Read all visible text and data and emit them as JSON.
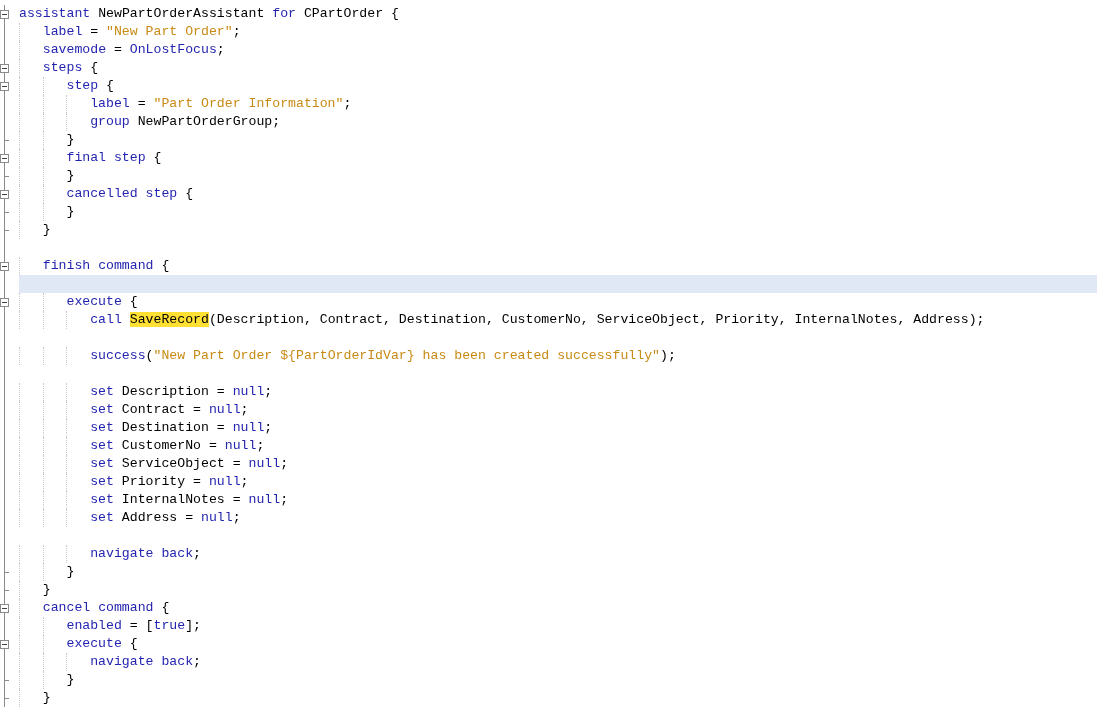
{
  "editor": {
    "lines": [
      {
        "kind": "open",
        "current": false,
        "tokens": [
          {
            "kind": "keyword",
            "text": "assistant "
          },
          {
            "kind": "plain",
            "text": "NewPartOrderAssistant "
          },
          {
            "kind": "keyword",
            "text": "for "
          },
          {
            "kind": "plain",
            "text": "CPartOrder {"
          }
        ]
      },
      {
        "kind": "none",
        "current": false,
        "tokens": [
          {
            "kind": "keyword",
            "text": "   label "
          },
          {
            "kind": "plain",
            "text": "= "
          },
          {
            "kind": "string",
            "text": "\"New Part Order\""
          },
          {
            "kind": "plain",
            "text": ";"
          }
        ]
      },
      {
        "kind": "none",
        "current": false,
        "tokens": [
          {
            "kind": "keyword",
            "text": "   savemode "
          },
          {
            "kind": "plain",
            "text": "= "
          },
          {
            "kind": "keyword",
            "text": "OnLostFocus"
          },
          {
            "kind": "plain",
            "text": ";"
          }
        ]
      },
      {
        "kind": "open",
        "current": false,
        "tokens": [
          {
            "kind": "keyword",
            "text": "   steps "
          },
          {
            "kind": "plain",
            "text": "{"
          }
        ]
      },
      {
        "kind": "open",
        "current": false,
        "tokens": [
          {
            "kind": "keyword",
            "text": "      step "
          },
          {
            "kind": "plain",
            "text": "{"
          }
        ]
      },
      {
        "kind": "none",
        "current": false,
        "tokens": [
          {
            "kind": "keyword",
            "text": "         label "
          },
          {
            "kind": "plain",
            "text": "= "
          },
          {
            "kind": "string",
            "text": "\"Part Order Information\""
          },
          {
            "kind": "plain",
            "text": ";"
          }
        ]
      },
      {
        "kind": "none",
        "current": false,
        "tokens": [
          {
            "kind": "keyword",
            "text": "         group "
          },
          {
            "kind": "plain",
            "text": "NewPartOrderGroup;"
          }
        ]
      },
      {
        "kind": "end",
        "current": false,
        "tokens": [
          {
            "kind": "plain",
            "text": "      }"
          }
        ]
      },
      {
        "kind": "open",
        "current": false,
        "tokens": [
          {
            "kind": "keyword",
            "text": "      final step "
          },
          {
            "kind": "plain",
            "text": "{"
          }
        ]
      },
      {
        "kind": "end",
        "current": false,
        "tokens": [
          {
            "kind": "plain",
            "text": "      }"
          }
        ]
      },
      {
        "kind": "open",
        "current": false,
        "tokens": [
          {
            "kind": "keyword",
            "text": "      cancelled step "
          },
          {
            "kind": "plain",
            "text": "{"
          }
        ]
      },
      {
        "kind": "end",
        "current": false,
        "tokens": [
          {
            "kind": "plain",
            "text": "      }"
          }
        ]
      },
      {
        "kind": "end",
        "current": false,
        "tokens": [
          {
            "kind": "plain",
            "text": "   }"
          }
        ]
      },
      {
        "kind": "none",
        "current": false
      },
      {
        "kind": "open",
        "current": false,
        "tokens": [
          {
            "kind": "keyword",
            "text": "   finish command "
          },
          {
            "kind": "plain",
            "text": "{"
          }
        ]
      },
      {
        "kind": "none",
        "current": true
      },
      {
        "kind": "open",
        "current": false,
        "tokens": [
          {
            "kind": "keyword",
            "text": "      execute "
          },
          {
            "kind": "plain",
            "text": "{"
          }
        ]
      },
      {
        "kind": "none",
        "current": false,
        "tokens": [
          {
            "kind": "keyword",
            "text": "         call "
          },
          {
            "kind": "highlighted",
            "text": "SaveRecord"
          },
          {
            "kind": "plain",
            "text": "(Description, Contract, Destination, CustomerNo, ServiceObject, Priority, InternalNotes, Address);"
          }
        ]
      },
      {
        "kind": "none",
        "current": false
      },
      {
        "kind": "none",
        "current": false,
        "tokens": [
          {
            "kind": "keyword",
            "text": "         success"
          },
          {
            "kind": "plain",
            "text": "("
          },
          {
            "kind": "string",
            "text": "\"New Part Order ${PartOrderIdVar} has been created successfully\""
          },
          {
            "kind": "plain",
            "text": ");"
          }
        ]
      },
      {
        "kind": "none",
        "current": false
      },
      {
        "kind": "none",
        "current": false,
        "tokens": [
          {
            "kind": "keyword",
            "text": "         set "
          },
          {
            "kind": "plain",
            "text": "Description = "
          },
          {
            "kind": "keyword",
            "text": "null"
          },
          {
            "kind": "plain",
            "text": ";"
          }
        ]
      },
      {
        "kind": "none",
        "current": false,
        "tokens": [
          {
            "kind": "keyword",
            "text": "         set "
          },
          {
            "kind": "plain",
            "text": "Contract = "
          },
          {
            "kind": "keyword",
            "text": "null"
          },
          {
            "kind": "plain",
            "text": ";"
          }
        ]
      },
      {
        "kind": "none",
        "current": false,
        "tokens": [
          {
            "kind": "keyword",
            "text": "         set "
          },
          {
            "kind": "plain",
            "text": "Destination = "
          },
          {
            "kind": "keyword",
            "text": "null"
          },
          {
            "kind": "plain",
            "text": ";"
          }
        ]
      },
      {
        "kind": "none",
        "current": false,
        "tokens": [
          {
            "kind": "keyword",
            "text": "         set "
          },
          {
            "kind": "plain",
            "text": "CustomerNo = "
          },
          {
            "kind": "keyword",
            "text": "null"
          },
          {
            "kind": "plain",
            "text": ";"
          }
        ]
      },
      {
        "kind": "none",
        "current": false,
        "tokens": [
          {
            "kind": "keyword",
            "text": "         set "
          },
          {
            "kind": "plain",
            "text": "ServiceObject = "
          },
          {
            "kind": "keyword",
            "text": "null"
          },
          {
            "kind": "plain",
            "text": ";"
          }
        ]
      },
      {
        "kind": "none",
        "current": false,
        "tokens": [
          {
            "kind": "keyword",
            "text": "         set "
          },
          {
            "kind": "plain",
            "text": "Priority = "
          },
          {
            "kind": "keyword",
            "text": "null"
          },
          {
            "kind": "plain",
            "text": ";"
          }
        ]
      },
      {
        "kind": "none",
        "current": false,
        "tokens": [
          {
            "kind": "keyword",
            "text": "         set "
          },
          {
            "kind": "plain",
            "text": "InternalNotes = "
          },
          {
            "kind": "keyword",
            "text": "null"
          },
          {
            "kind": "plain",
            "text": ";"
          }
        ]
      },
      {
        "kind": "none",
        "current": false,
        "tokens": [
          {
            "kind": "keyword",
            "text": "         set "
          },
          {
            "kind": "plain",
            "text": "Address = "
          },
          {
            "kind": "keyword",
            "text": "null"
          },
          {
            "kind": "plain",
            "text": ";"
          }
        ]
      },
      {
        "kind": "none",
        "current": false
      },
      {
        "kind": "none",
        "current": false,
        "tokens": [
          {
            "kind": "keyword",
            "text": "         navigate back"
          },
          {
            "kind": "plain",
            "text": ";"
          }
        ]
      },
      {
        "kind": "end",
        "current": false,
        "tokens": [
          {
            "kind": "plain",
            "text": "      }"
          }
        ]
      },
      {
        "kind": "end",
        "current": false,
        "tokens": [
          {
            "kind": "plain",
            "text": "   }"
          }
        ]
      },
      {
        "kind": "open",
        "current": false,
        "tokens": [
          {
            "kind": "keyword",
            "text": "   cancel command "
          },
          {
            "kind": "plain",
            "text": "{"
          }
        ]
      },
      {
        "kind": "none",
        "current": false,
        "tokens": [
          {
            "kind": "keyword",
            "text": "      enabled "
          },
          {
            "kind": "plain",
            "text": "= ["
          },
          {
            "kind": "keyword",
            "text": "true"
          },
          {
            "kind": "plain",
            "text": "];"
          }
        ]
      },
      {
        "kind": "open",
        "current": false,
        "tokens": [
          {
            "kind": "keyword",
            "text": "      execute "
          },
          {
            "kind": "plain",
            "text": "{"
          }
        ]
      },
      {
        "kind": "none",
        "current": false,
        "tokens": [
          {
            "kind": "keyword",
            "text": "         navigate back"
          },
          {
            "kind": "plain",
            "text": ";"
          }
        ]
      },
      {
        "kind": "end",
        "current": false,
        "tokens": [
          {
            "kind": "plain",
            "text": "      }"
          }
        ]
      },
      {
        "kind": "end",
        "current": false,
        "tokens": [
          {
            "kind": "plain",
            "text": "   }"
          }
        ]
      }
    ]
  }
}
